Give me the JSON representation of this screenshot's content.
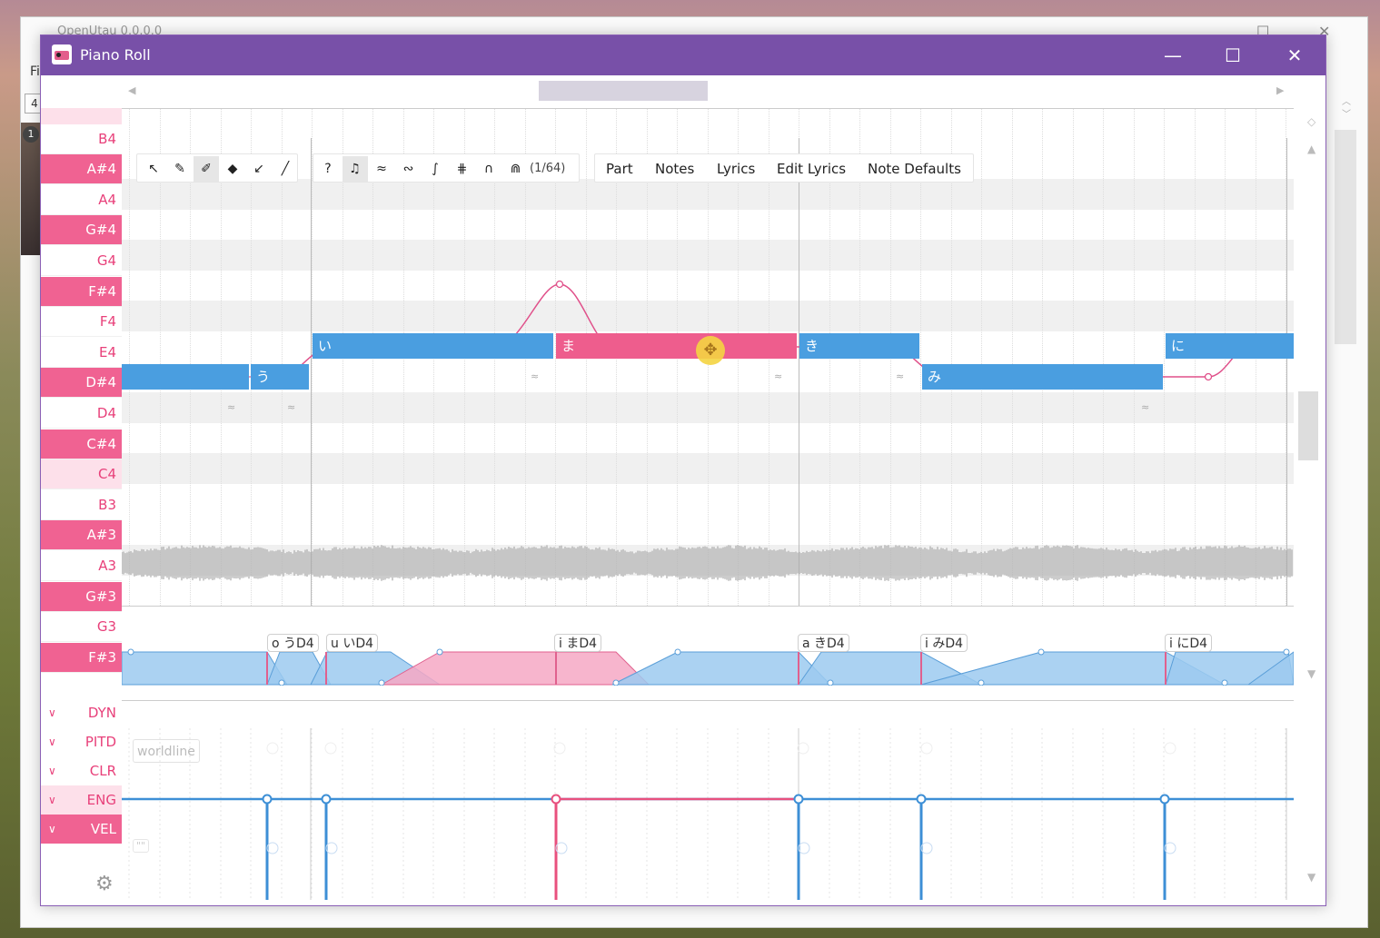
{
  "background_window": {
    "title": "OpenUtau 0.0.0.0",
    "menu_fragment": "Fi",
    "box_value": "4",
    "avatar_badge": "1",
    "maximize_glyph": "☐",
    "close_glyph": "✕"
  },
  "window": {
    "title": "Piano Roll",
    "minimize_glyph": "—",
    "maximize_glyph": "☐",
    "close_glyph": "✕"
  },
  "scroll": {
    "left_arrow": "◀",
    "right_arrow": "▶",
    "up_arrow": "▲",
    "down_arrow": "▼",
    "diamond": "◇"
  },
  "piano_keys": [
    {
      "label": "",
      "type": "c"
    },
    {
      "label": "B4",
      "type": "white"
    },
    {
      "label": "A#4",
      "type": "black"
    },
    {
      "label": "A4",
      "type": "white"
    },
    {
      "label": "G#4",
      "type": "black"
    },
    {
      "label": "G4",
      "type": "white"
    },
    {
      "label": "F#4",
      "type": "black"
    },
    {
      "label": "F4",
      "type": "white"
    },
    {
      "label": "E4",
      "type": "white"
    },
    {
      "label": "D#4",
      "type": "black"
    },
    {
      "label": "D4",
      "type": "white"
    },
    {
      "label": "C#4",
      "type": "black"
    },
    {
      "label": "C4",
      "type": "c"
    },
    {
      "label": "B3",
      "type": "white"
    },
    {
      "label": "A#3",
      "type": "black"
    },
    {
      "label": "A3",
      "type": "white"
    },
    {
      "label": "G#3",
      "type": "black"
    },
    {
      "label": "G3",
      "type": "white"
    },
    {
      "label": "F#3",
      "type": "black"
    }
  ],
  "toolbar": {
    "tools": [
      {
        "name": "selection-tool-icon",
        "glyph": "↖",
        "active": false
      },
      {
        "name": "pen-tool-icon",
        "glyph": "✎",
        "active": false
      },
      {
        "name": "pen-plus-tool-icon",
        "glyph": "✐",
        "active": true
      },
      {
        "name": "eraser-tool-icon",
        "glyph": "◆",
        "active": false
      },
      {
        "name": "draw-pitch-tool-icon",
        "glyph": "↙",
        "active": false
      },
      {
        "name": "knife-tool-icon",
        "glyph": "╱",
        "active": false
      }
    ],
    "toggles": [
      {
        "name": "tips-icon",
        "glyph": "?",
        "active": false
      },
      {
        "name": "play-tone-icon",
        "glyph": "♫",
        "active": true
      },
      {
        "name": "show-vibrato-icon",
        "glyph": "≈",
        "active": false
      },
      {
        "name": "show-pitch-icon",
        "glyph": "∾",
        "active": false
      },
      {
        "name": "snap-pitch-icon",
        "glyph": "∫",
        "active": false
      },
      {
        "name": "show-waveform-icon",
        "glyph": "⋕",
        "active": false
      },
      {
        "name": "show-portamento-icon",
        "glyph": "∩",
        "active": false
      },
      {
        "name": "show-phoneme-icon",
        "glyph": "⋒",
        "active": false
      }
    ],
    "snap_label": "(1/64)",
    "menus": [
      "Part",
      "Notes",
      "Lyrics",
      "Edit Lyrics",
      "Note Defaults"
    ]
  },
  "notes": [
    {
      "lyric": "",
      "color": "blue"
    },
    {
      "lyric": "う",
      "color": "blue"
    },
    {
      "lyric": "い",
      "color": "blue"
    },
    {
      "lyric": "ま",
      "color": "pink"
    },
    {
      "lyric": "き",
      "color": "blue"
    },
    {
      "lyric": "み",
      "color": "blue"
    },
    {
      "lyric": "に",
      "color": "blue"
    }
  ],
  "vibrato_glyph": "≈",
  "phonemes": [
    "o うD4",
    "u いD4",
    "i まD4",
    "a きD4",
    "i みD4",
    "i にD4"
  ],
  "expressions": [
    {
      "label": "DYN",
      "state": "normal"
    },
    {
      "label": "PITD",
      "state": "normal"
    },
    {
      "label": "CLR",
      "state": "normal"
    },
    {
      "label": "ENG",
      "state": "selected"
    },
    {
      "label": "VEL",
      "state": "active"
    }
  ],
  "expression_chevron": "∨",
  "worldline_label": "worldline",
  "empty_quote_label": "\"\"",
  "gear_glyph": "⚙",
  "colors": {
    "title_bar": "#7850a8",
    "note_blue": "#4a9ee0",
    "note_pink": "#ee5d8d",
    "key_black": "#f06292",
    "key_label": "#e8407a"
  }
}
